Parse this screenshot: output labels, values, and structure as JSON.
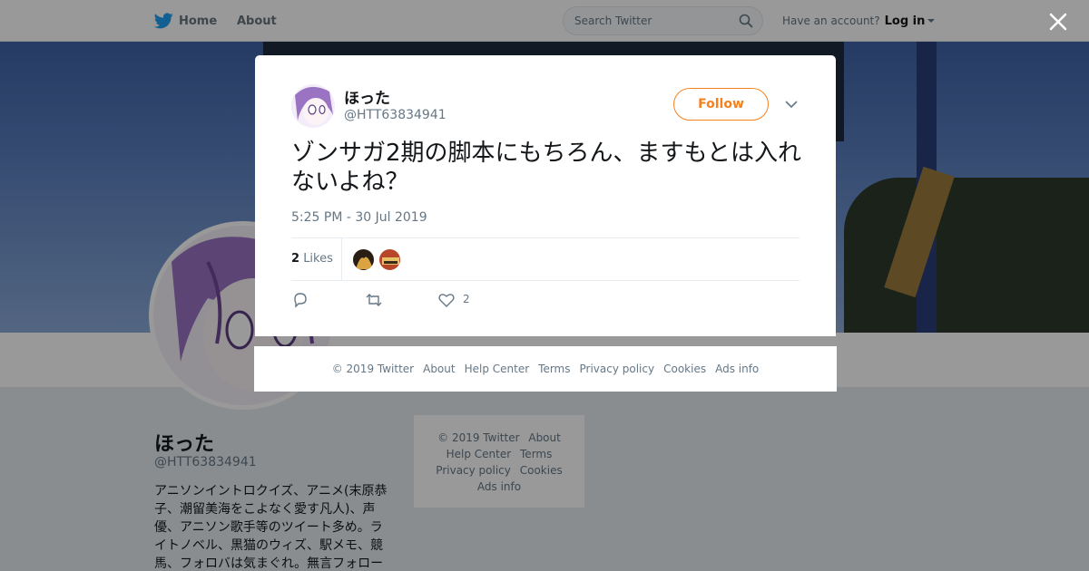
{
  "nav": {
    "home": "Home",
    "about": "About",
    "search_placeholder": "Search Twitter",
    "have_account": "Have an account?",
    "login": "Log in"
  },
  "profile": {
    "name": "ほった",
    "handle": "@HTT63834941",
    "bio": "アニソンイントロクイズ、アニメ(末原恭子、潮留美海をこよなく愛す凡人)、声優、アニソン歌手等のツイート多め。ライトノベル、黒猫のウィズ、駅メモ、競馬、フォロバは気まぐれ。無言フォロー"
  },
  "side_footer": {
    "copyright": "© 2019 Twitter",
    "about": "About",
    "help": "Help Center",
    "terms": "Terms",
    "privacy": "Privacy policy",
    "cookies": "Cookies",
    "ads": "Ads info"
  },
  "tweet": {
    "name": "ほった",
    "handle": "@HTT63834941",
    "follow": "Follow",
    "text": "ゾンサガ2期の脚本にもちろん、ますもとは入れないよね？",
    "time": "5:25 PM - 30 Jul 2019",
    "likes_number": "2",
    "likes_label": "Likes",
    "like_action_count": "2"
  },
  "modal_footer": {
    "copyright": "© 2019 Twitter",
    "about": "About",
    "help": "Help Center",
    "terms": "Terms",
    "privacy": "Privacy policy",
    "cookies": "Cookies",
    "ads": "Ads info"
  },
  "colors": {
    "accent": "#f4811f",
    "twitter_blue": "#1da1f2",
    "muted_text": "#657786"
  },
  "icons": [
    "twitter-bird-icon",
    "search-icon",
    "close-icon",
    "chevron-down-icon",
    "reply-icon",
    "retweet-icon",
    "heart-icon"
  ]
}
